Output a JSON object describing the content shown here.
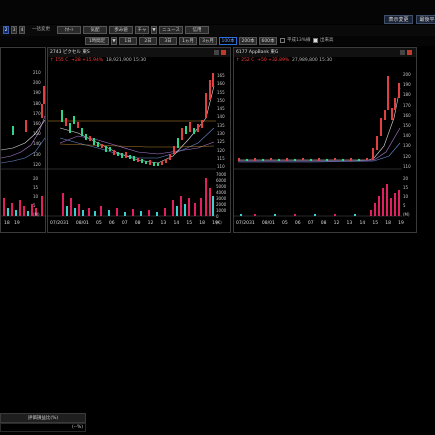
{
  "header": {
    "btn1": "表示変更",
    "btn2": "最後平"
  },
  "toolbar": {
    "nums": [
      "2",
      "3",
      "4"
    ],
    "mode_label": "一括変更",
    "buttons": [
      "ｸｵｰﾄ",
      "気配",
      "歩み値",
      "チャート",
      "ニュース",
      "信用"
    ],
    "arrow": "▼",
    "period_select": "1時間足",
    "period_arrow": "▼",
    "ranges": [
      "1日",
      "2日",
      "3日",
      "1ヵ月",
      "3ヵ月",
      "100本",
      "200本",
      "600本"
    ],
    "selected_range": "100本",
    "checkbox1_label": "平成13%線",
    "checkbox2_label": "出来高"
  },
  "panels": [
    {
      "code_name": "",
      "quote": "",
      "y_ticks": [
        "210",
        "200",
        "190",
        "180",
        "170",
        "160",
        "150",
        "140",
        "130",
        "120"
      ],
      "v_ticks": [
        "20",
        "15",
        "10",
        "5"
      ],
      "v_unit": "(M)",
      "x_labels": [
        "18",
        "19"
      ]
    },
    {
      "code_name": "2743 ピクセル 東S",
      "quote_price": "↑ 155 C",
      "quote_change": "+28 +15.94%",
      "quote_volume": "18,921,900 15:30",
      "y_ticks": [
        "165",
        "160",
        "155",
        "150",
        "145",
        "140",
        "135",
        "130",
        "125",
        "120",
        "115",
        "110"
      ],
      "v_ticks": [
        "7000",
        "6000",
        "5000",
        "4000",
        "3000",
        "2000",
        "1000",
        "0"
      ],
      "v_unit": "(K)",
      "x_labels": [
        "07/2031",
        "08/01",
        "05",
        "06",
        "07",
        "08",
        "12",
        "13",
        "14",
        "15",
        "18",
        "19"
      ]
    },
    {
      "code_name": "6177 AppBank 東G",
      "quote_price": "↑ 252 C",
      "quote_change": "+50 +32.89%",
      "quote_volume": "27,989,800 15:30",
      "y_ticks": [
        "200",
        "190",
        "180",
        "170",
        "160",
        "150",
        "140",
        "130",
        "120",
        "110"
      ],
      "v_ticks": [
        "20",
        "15",
        "10",
        "5"
      ],
      "v_unit": "(M)",
      "x_labels": [
        "07/2031",
        "08/01",
        "05",
        "06",
        "07",
        "08",
        "12",
        "13",
        "14",
        "15",
        "18",
        "19"
      ]
    }
  ],
  "bottom": {
    "header": "評価損益比(%)",
    "value": "(--%)"
  }
}
